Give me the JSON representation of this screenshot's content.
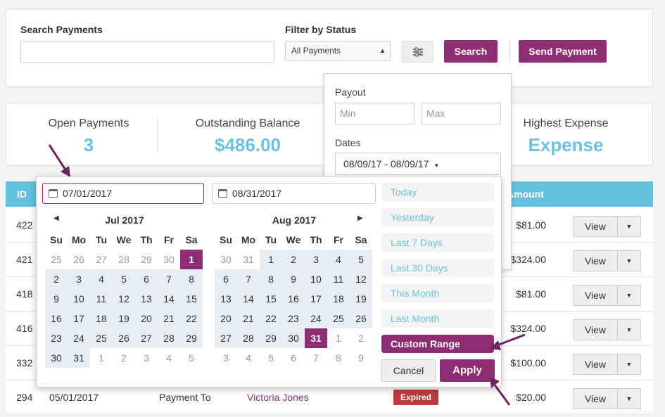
{
  "search": {
    "label": "Search Payments",
    "placeholder": "",
    "filter_label": "Filter by Status",
    "filter_value": "All Payments",
    "search_button": "Search",
    "send_button": "Send Payment"
  },
  "stats": [
    {
      "label": "Open Payments",
      "value": "3"
    },
    {
      "label": "Outstanding Balance",
      "value": "$486.00"
    },
    {
      "label": "Highest Expense",
      "value": "Expense"
    }
  ],
  "table": {
    "headers": {
      "id": "ID",
      "amount": "Amount"
    },
    "rows": [
      {
        "id": "422",
        "amount": "$81.00",
        "view": "View"
      },
      {
        "id": "421",
        "amount": "$324.00",
        "view": "View"
      },
      {
        "id": "418",
        "amount": "$81.00",
        "view": "View"
      },
      {
        "id": "416",
        "amount": "$324.00",
        "view": "View"
      },
      {
        "id": "332",
        "amount": "$100.00",
        "view": "View"
      },
      {
        "id": "294",
        "date": "05/01/2017",
        "type": "Payment To",
        "name": "Victoria Jones",
        "status": "Expired",
        "amount": "$20.00",
        "view": "View"
      }
    ]
  },
  "payout": {
    "label": "Payout",
    "min_placeholder": "Min",
    "max_placeholder": "Max",
    "dates_label": "Dates",
    "dates_value": "08/09/17 - 08/09/17"
  },
  "calendar": {
    "start_input": "07/01/2017",
    "end_input": "08/31/2017",
    "weekdays": [
      "Su",
      "Mo",
      "Tu",
      "We",
      "Th",
      "Fr",
      "Sa"
    ],
    "months": [
      {
        "title": "Jul 2017",
        "days": [
          "25",
          "26",
          "27",
          "28",
          "29",
          "30",
          "1",
          "2",
          "3",
          "4",
          "5",
          "6",
          "7",
          "8",
          "9",
          "10",
          "11",
          "12",
          "13",
          "14",
          "15",
          "16",
          "17",
          "18",
          "19",
          "20",
          "21",
          "22",
          "23",
          "24",
          "25",
          "26",
          "27",
          "28",
          "29",
          "30",
          "31",
          "1",
          "2",
          "3",
          "4",
          "5"
        ],
        "first_in": 6,
        "last_in": 36,
        "selected": 6
      },
      {
        "title": "Aug 2017",
        "days": [
          "30",
          "31",
          "1",
          "2",
          "3",
          "4",
          "5",
          "6",
          "7",
          "8",
          "9",
          "10",
          "11",
          "12",
          "13",
          "14",
          "15",
          "16",
          "17",
          "18",
          "19",
          "20",
          "21",
          "22",
          "23",
          "24",
          "25",
          "26",
          "27",
          "28",
          "29",
          "30",
          "31",
          "1",
          "2",
          "3",
          "4",
          "5",
          "6",
          "7",
          "8",
          "9"
        ],
        "first_in": 2,
        "last_in": 32,
        "selected": 32
      }
    ],
    "ranges": [
      "Today",
      "Yesterday",
      "Last 7 Days",
      "Last 30 Days",
      "This Month",
      "Last Month",
      "Custom Range"
    ],
    "active_range": "Custom Range",
    "cancel": "Cancel",
    "apply": "Apply"
  },
  "colors": {
    "accent": "#8e2d74",
    "highlight": "#6ec1de",
    "header": "#63c1df"
  }
}
